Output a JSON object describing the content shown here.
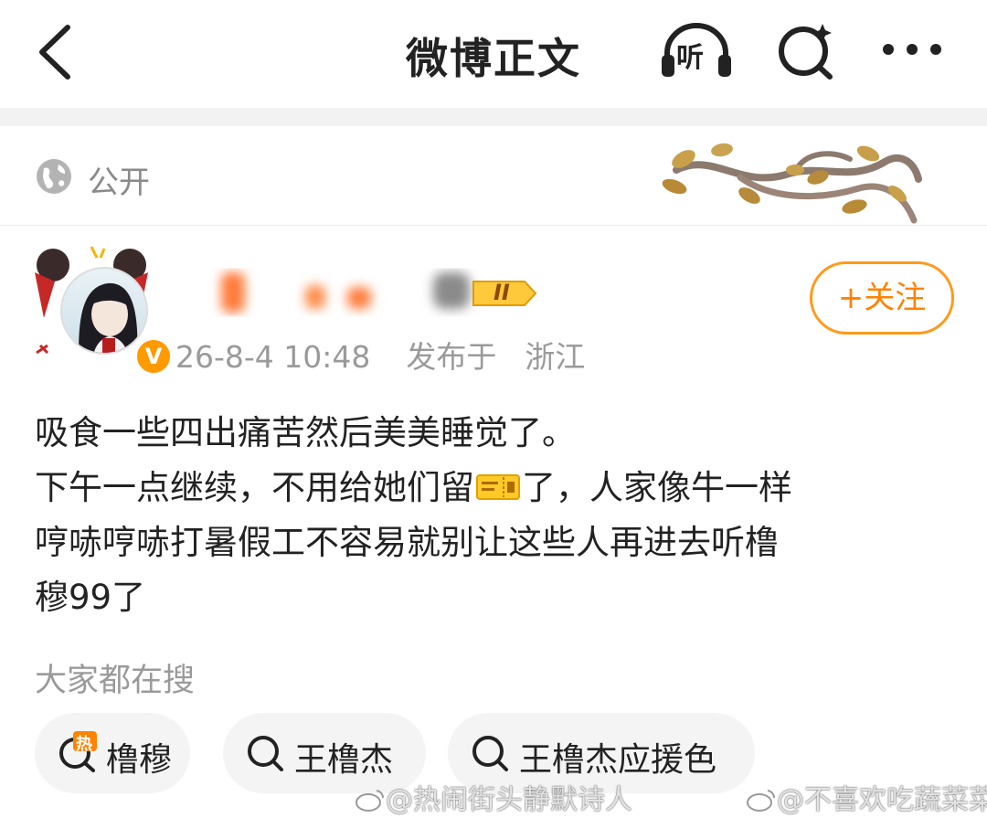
{
  "header": {
    "title": "微博正文",
    "listen_label": "听"
  },
  "visibility": {
    "label": "公开"
  },
  "author": {
    "verified_mark": "V",
    "level": "II",
    "post_time": "26-8-4 10:48",
    "location_prefix": "发布于",
    "location": "浙江",
    "follow_label": "+关注"
  },
  "post": {
    "lines": [
      "吸食一些四出痛苦然后美美睡觉了。",
      "下午一点继续，不用给她们留",
      "了，人家像牛一样",
      "哼哧哼哧打暑假工不容易就别让这些人再进去听橹",
      "穆99了"
    ]
  },
  "trending": {
    "title": "大家都在搜",
    "chips": [
      {
        "label": "橹穆",
        "hot_mark": "热"
      },
      {
        "label": "王橹杰"
      },
      {
        "label": "王橹杰应援色"
      }
    ]
  },
  "watermarks": [
    "@热闹街头静默诗人",
    "@不喜欢吃蔬菜菜"
  ],
  "colors": {
    "accent": "#ff8200",
    "muted_text": "#9a9a9a",
    "chip_bg": "#f4f4f4"
  }
}
